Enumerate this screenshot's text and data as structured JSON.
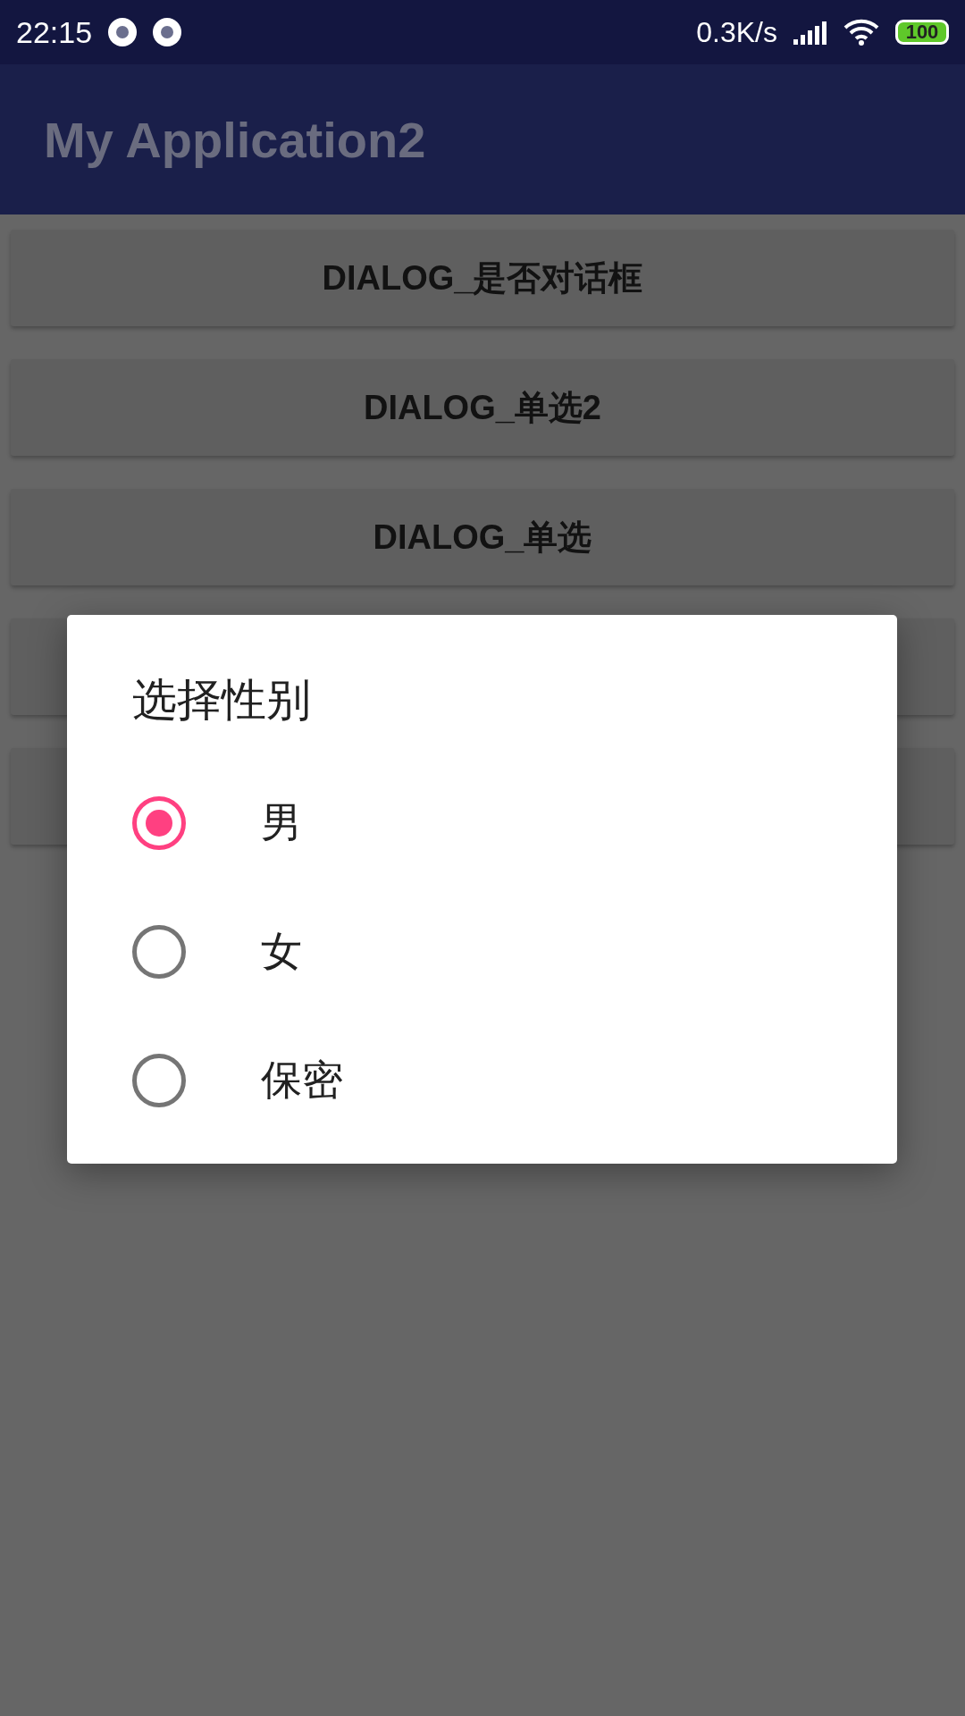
{
  "status_bar": {
    "time": "22:15",
    "net_speed": "0.3K/s",
    "battery": "100"
  },
  "app_bar": {
    "title": "My Application2"
  },
  "buttons": [
    {
      "kind": "labeled",
      "label": "DIALOG_是否对话框"
    },
    {
      "kind": "labeled",
      "label": "DIALOG_单选2"
    },
    {
      "kind": "labeled",
      "label": "DIALOG_单选"
    },
    {
      "kind": "covered"
    },
    {
      "kind": "covered"
    }
  ],
  "dialog": {
    "title": "选择性别",
    "options": [
      {
        "label": "男",
        "selected": true
      },
      {
        "label": "女",
        "selected": false
      },
      {
        "label": "保密",
        "selected": false
      }
    ]
  }
}
